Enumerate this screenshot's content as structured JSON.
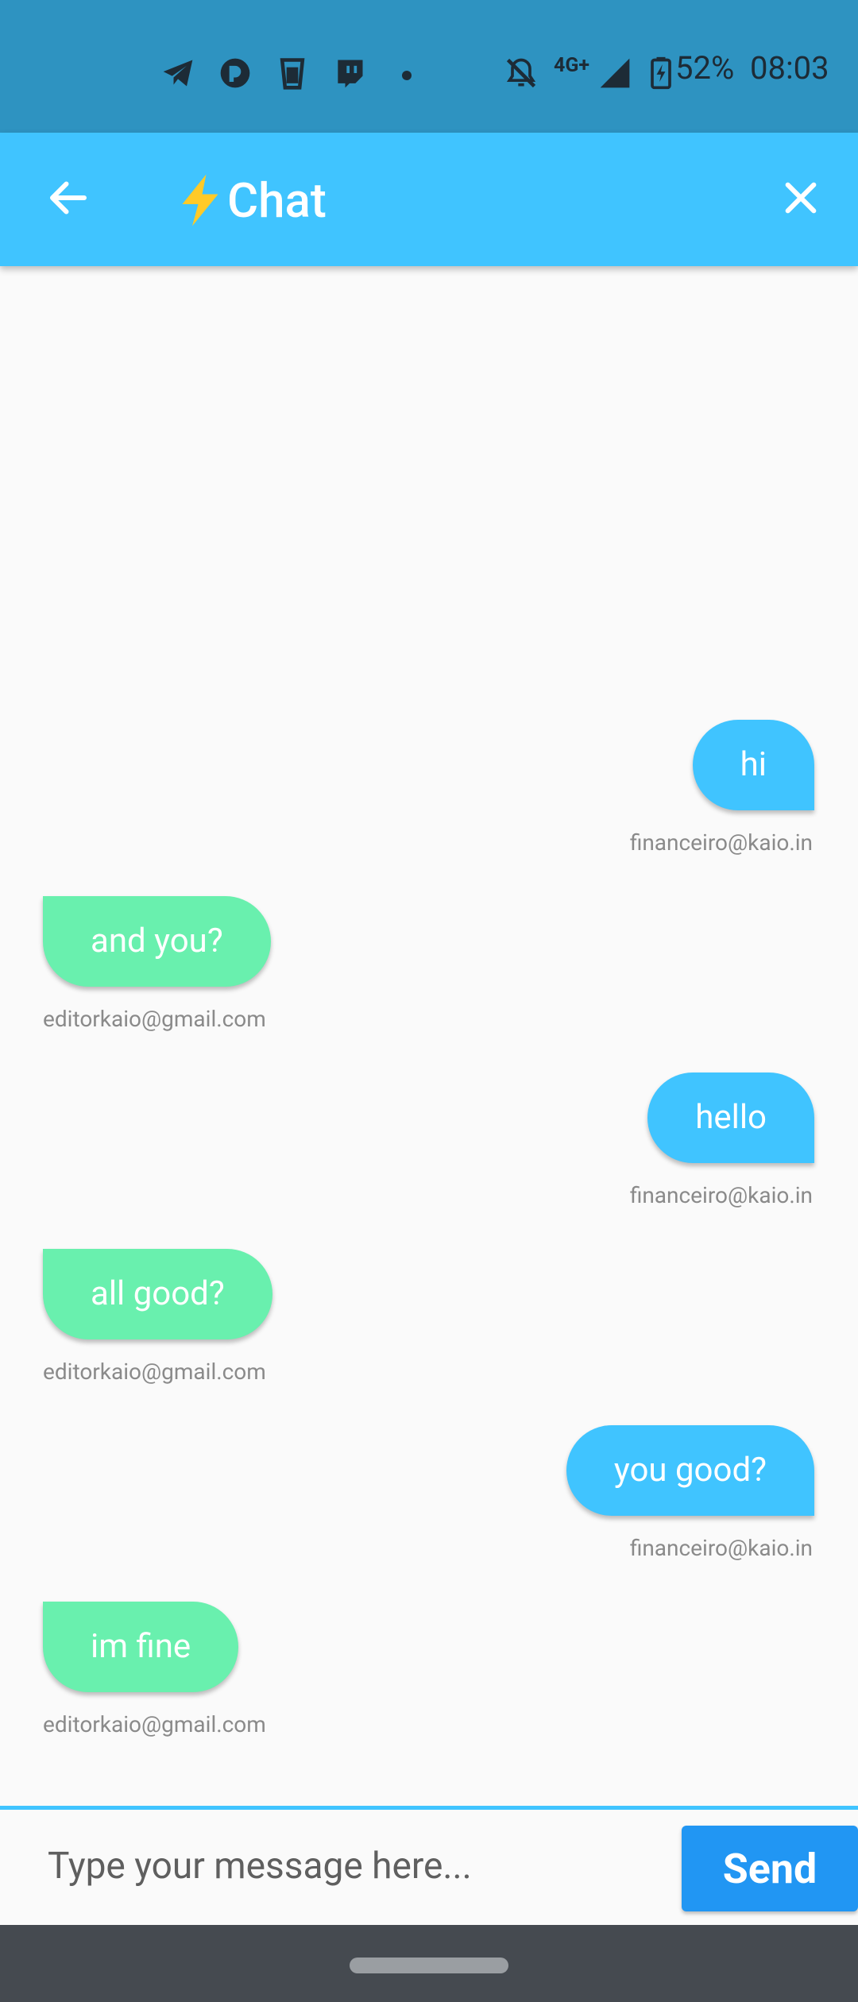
{
  "status_bar": {
    "battery": "52%",
    "time": "08:03",
    "network": "4G+",
    "icons": [
      "telegram-icon",
      "browser-icon",
      "glass-icon",
      "twitch-icon",
      "mute-bell-icon",
      "signal-icon",
      "battery-charging-icon"
    ]
  },
  "appbar": {
    "title_emoji": "⚡",
    "title": "Chat",
    "back_icon": "arrow-back-icon",
    "close_icon": "close-icon",
    "color": "#40c4ff"
  },
  "messages": [
    {
      "text": "hi",
      "sender": "financeiro@kaio.in",
      "direction": "outgoing"
    },
    {
      "text": "and you?",
      "sender": "editorkaio@gmail.com",
      "direction": "incoming"
    },
    {
      "text": "hello",
      "sender": "financeiro@kaio.in",
      "direction": "outgoing"
    },
    {
      "text": "all good?",
      "sender": "editorkaio@gmail.com",
      "direction": "incoming"
    },
    {
      "text": "you good?",
      "sender": "financeiro@kaio.in",
      "direction": "outgoing"
    },
    {
      "text": "im fine",
      "sender": "editorkaio@gmail.com",
      "direction": "incoming"
    }
  ],
  "composer": {
    "placeholder": "Type your message here...",
    "value": "",
    "send_label": "Send"
  },
  "colors": {
    "outgoing_bubble": "#40c4ff",
    "incoming_bubble": "#69f0ae",
    "send_button": "#2196f3"
  }
}
